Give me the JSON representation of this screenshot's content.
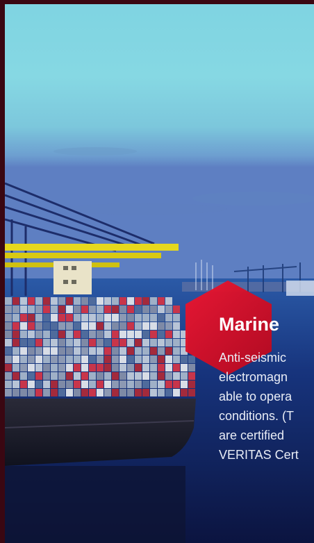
{
  "slide": {
    "title": "Marine",
    "description_lines": [
      "Anti-seismic",
      "electromagn",
      "able to opera",
      "conditions. (T",
      "are certified",
      "VERITAS Cert"
    ],
    "accent_color": "#e10a24"
  },
  "icons": {
    "badge": "hexagon-icon"
  }
}
